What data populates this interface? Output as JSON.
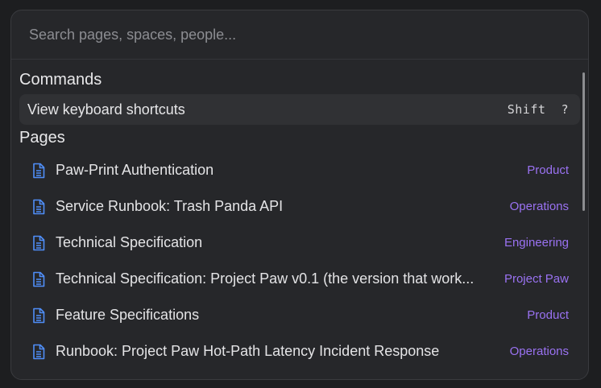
{
  "search": {
    "placeholder": "Search pages, spaces, people..."
  },
  "commands": {
    "heading": "Commands",
    "items": [
      {
        "label": "View keyboard shortcuts",
        "shortcut": "Shift  ?"
      }
    ]
  },
  "pages": {
    "heading": "Pages",
    "items": [
      {
        "title": "Paw-Print Authentication",
        "space": "Product",
        "icon": "document-icon"
      },
      {
        "title": "Service Runbook: Trash Panda API",
        "space": "Operations",
        "icon": "document-icon"
      },
      {
        "title": "Technical Specification",
        "space": "Engineering",
        "icon": "document-icon"
      },
      {
        "title": "Technical Specification: Project Paw v0.1 (the version that work...",
        "space": "Project Paw",
        "icon": "document-icon"
      },
      {
        "title": "Feature Specifications",
        "space": "Product",
        "icon": "document-icon"
      },
      {
        "title": "Runbook: Project Paw Hot-Path Latency Incident Response",
        "space": "Operations",
        "icon": "document-icon"
      }
    ]
  },
  "colors": {
    "accent": "#9a72f2",
    "icon": "#4f8ef7",
    "background": "#26272a"
  }
}
